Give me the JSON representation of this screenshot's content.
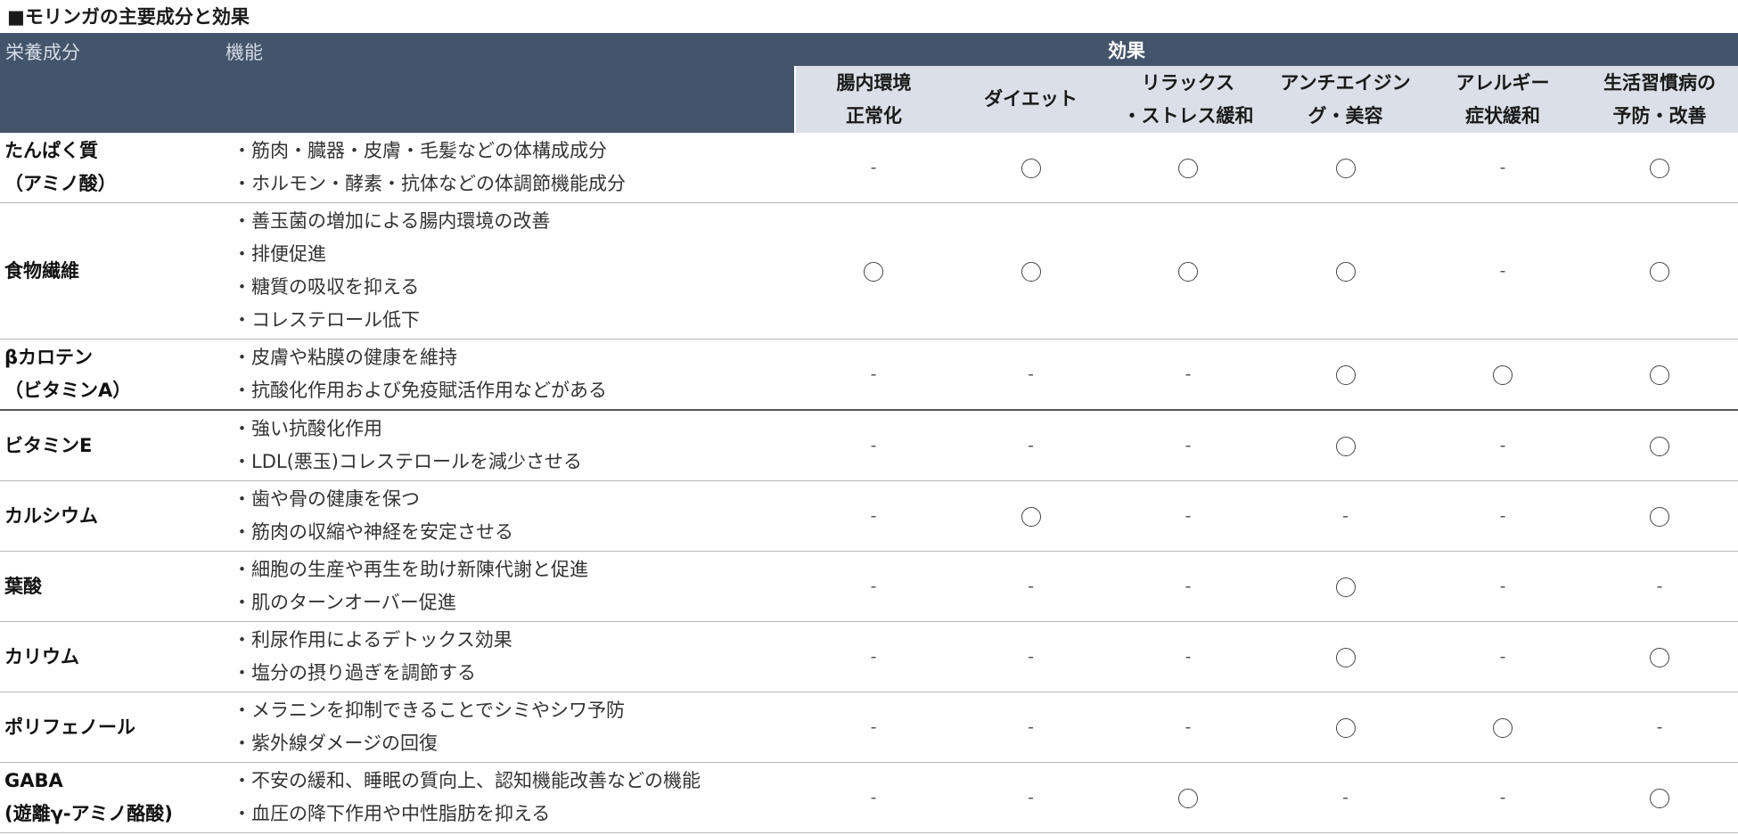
{
  "title": "■モリンガの主要成分と効果",
  "header": {
    "nutrient": "栄養成分",
    "function": "機能",
    "effects": "効果",
    "effect_columns": [
      "腸内環境\n正常化",
      "ダイエット",
      "リラックス\n・ストレス緩和",
      "アンチエイジン\nグ・美容",
      "アレルギー\n症状緩和",
      "生活習慣病の\n予防・改善"
    ]
  },
  "rows": [
    {
      "nutrient": "たんぱく質\n（アミノ酸）",
      "functions": [
        "・筋肉・臓器・皮膚・毛髪などの体構成成分",
        "・ホルモン・酵素・抗体などの体調節機能成分"
      ],
      "effects": [
        "-",
        "○",
        "○",
        "○",
        "-",
        "○"
      ]
    },
    {
      "nutrient": "食物繊維",
      "functions": [
        "・善玉菌の増加による腸内環境の改善",
        "・排便促進",
        "・糖質の吸収を抑える",
        "・コレステロール低下"
      ],
      "effects": [
        "○",
        "○",
        "○",
        "○",
        "-",
        "○"
      ]
    },
    {
      "nutrient": "βカロテン\n（ビタミンA）",
      "functions": [
        "・皮膚や粘膜の健康を維持",
        "・抗酸化作用および免疫賦活作用などがある"
      ],
      "effects": [
        "-",
        "-",
        "-",
        "○",
        "○",
        "○"
      ]
    },
    {
      "nutrient": "ビタミンE",
      "functions": [
        "・強い抗酸化作用",
        "・LDL(悪玉)コレステロールを減少させる"
      ],
      "effects": [
        "-",
        "-",
        "-",
        "○",
        "-",
        "○"
      ]
    },
    {
      "nutrient": "カルシウム",
      "functions": [
        "・歯や骨の健康を保つ",
        "・筋肉の収縮や神経を安定させる"
      ],
      "effects": [
        "-",
        "○",
        "-",
        "-",
        "-",
        "○"
      ]
    },
    {
      "nutrient": "葉酸",
      "functions": [
        "・細胞の生産や再生を助け新陳代謝と促進",
        "・肌のターンオーバー促進"
      ],
      "effects": [
        "-",
        "-",
        "-",
        "○",
        "-",
        "-"
      ]
    },
    {
      "nutrient": "カリウム",
      "functions": [
        "・利尿作用によるデトックス効果",
        "・塩分の摂り過ぎを調節する"
      ],
      "effects": [
        "-",
        "-",
        "-",
        "○",
        "-",
        "○"
      ]
    },
    {
      "nutrient": "ポリフェノール",
      "functions": [
        "・メラニンを抑制できることでシミやシワ予防",
        "・紫外線ダメージの回復"
      ],
      "effects": [
        "-",
        "-",
        "-",
        "○",
        "○",
        "-"
      ]
    },
    {
      "nutrient": "GABA\n(遊離γ-アミノ酪酸)",
      "functions": [
        "・不安の緩和、睡眠の質向上、認知機能改善などの機能",
        "・血圧の降下作用や中性脂肪を抑える"
      ],
      "effects": [
        "-",
        "-",
        "○",
        "-",
        "-",
        "○"
      ]
    }
  ]
}
